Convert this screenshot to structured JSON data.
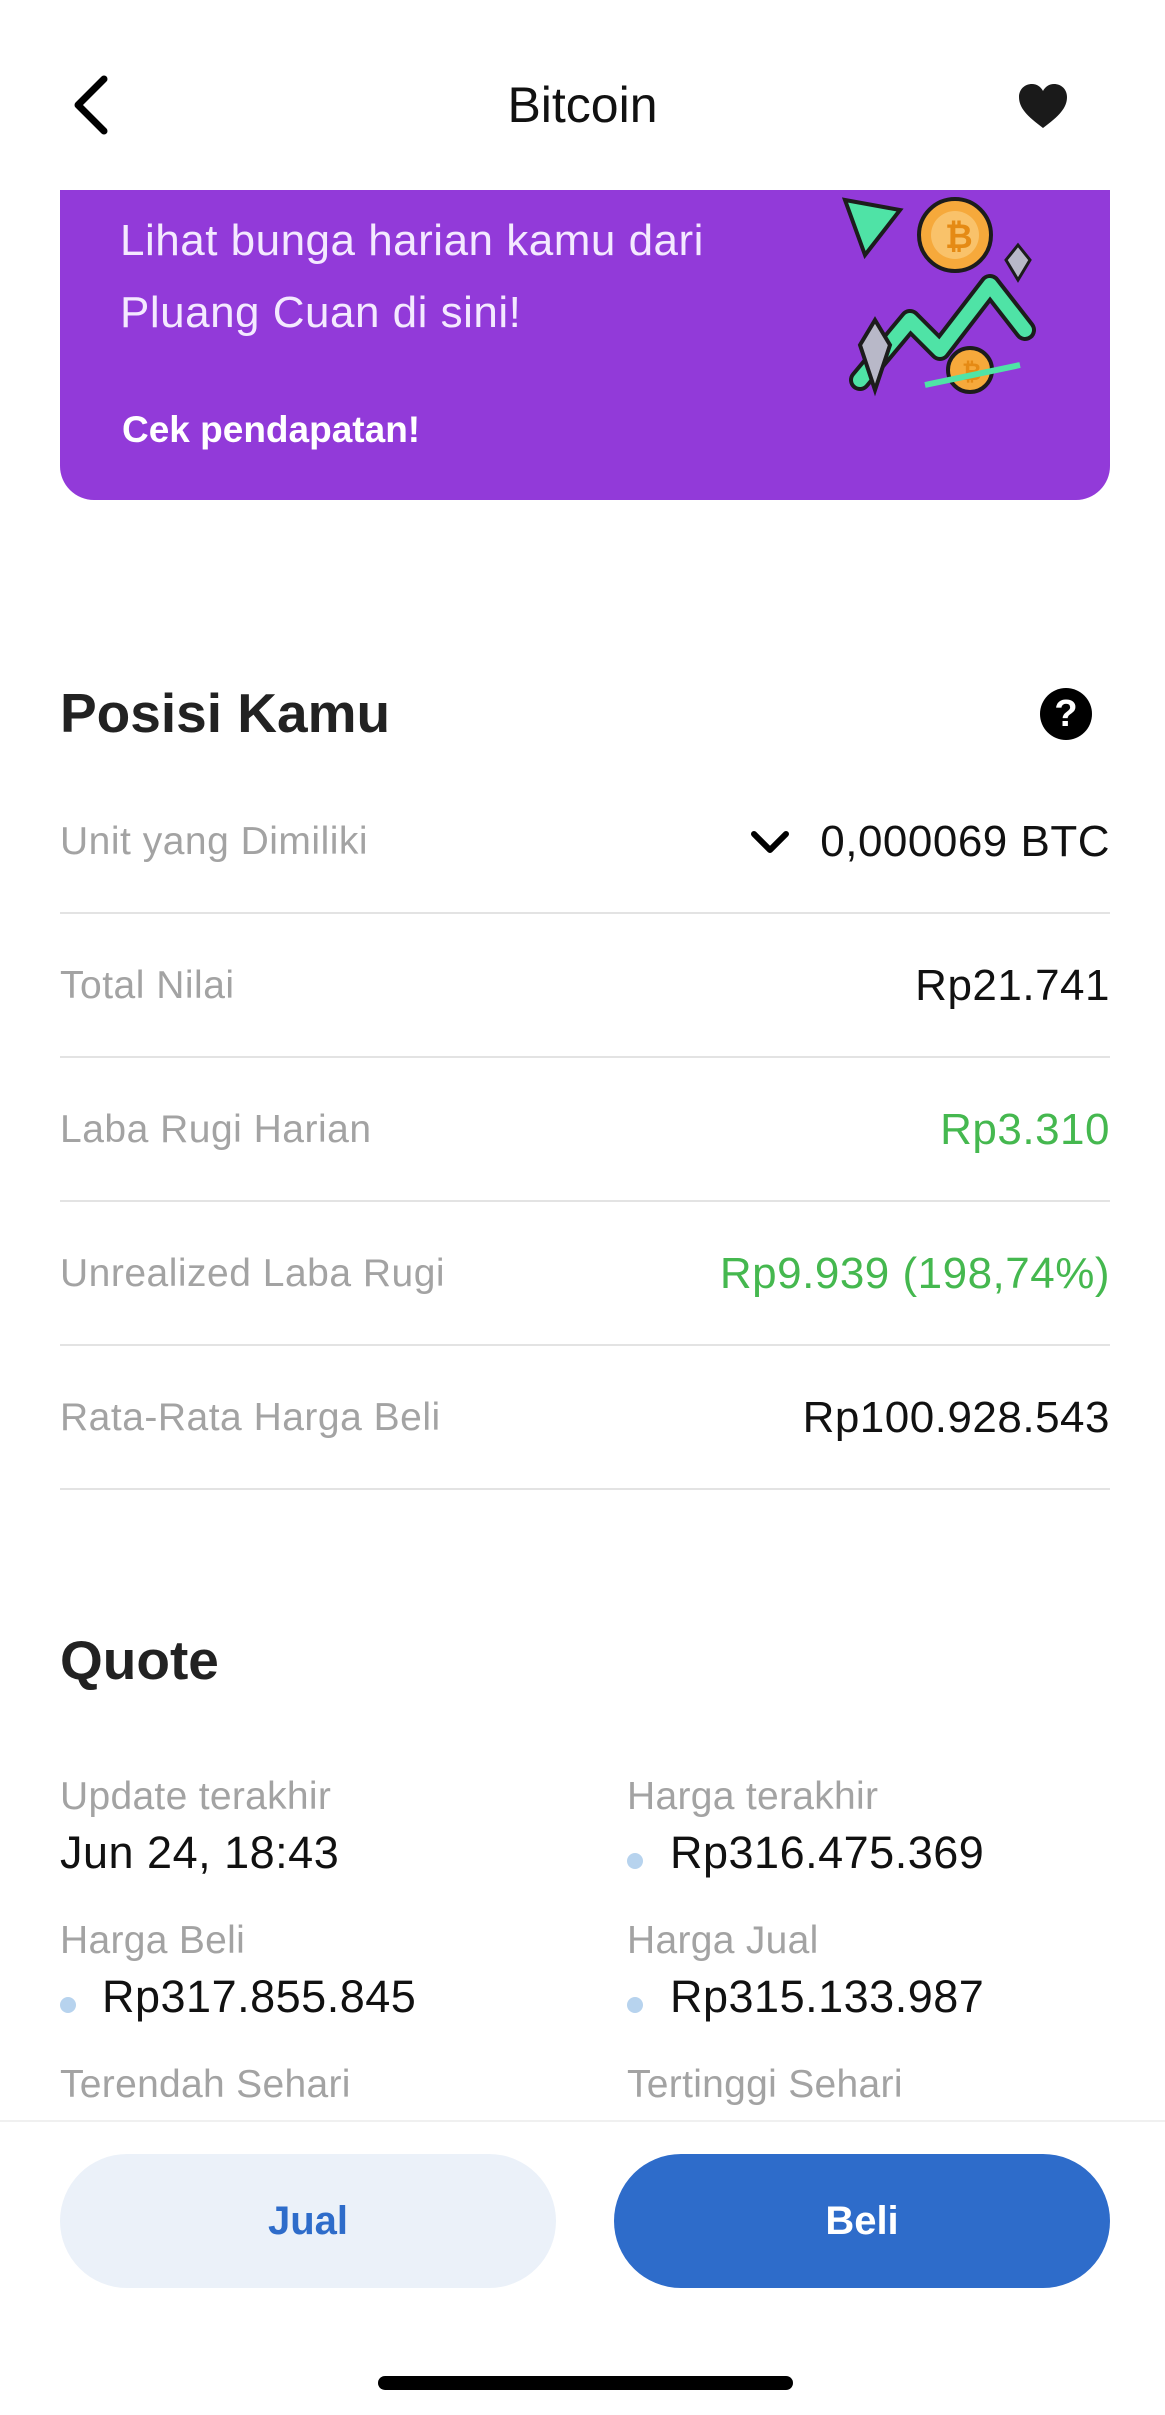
{
  "header": {
    "title": "Bitcoin",
    "back_icon": "chevron-left-icon",
    "favorite_icon": "heart-icon"
  },
  "promo": {
    "line1": "Lihat bunga harian kamu dari",
    "line2": "Pluang Cuan di sini!",
    "cta": "Cek pendapatan!",
    "background_color": "#923ad9",
    "illustration_icon": "crypto-growth-chart-icon"
  },
  "position": {
    "title": "Posisi Kamu",
    "help_label": "?",
    "rows": [
      {
        "label": "Unit yang Dimiliki",
        "value": "0,000069 BTC"
      },
      {
        "label": "Total Nilai",
        "value": "Rp21.741"
      },
      {
        "label": "Laba Rugi Harian",
        "value": "Rp3.310"
      },
      {
        "label": "Unrealized Laba Rugi",
        "value": "Rp9.939 (198,74%)"
      },
      {
        "label": "Rata-Rata Harga Beli",
        "value": "Rp100.928.543"
      }
    ],
    "positive_color": "#45b84f"
  },
  "quote": {
    "title": "Quote",
    "last_update_label": "Update terakhir",
    "last_update_value": "Jun 24, 18:43",
    "last_price_label": "Harga terakhir",
    "last_price_value": "Rp316.475.369",
    "buy_price_label": "Harga Beli",
    "buy_price_value": "Rp317.855.845",
    "sell_price_label": "Harga Jual",
    "sell_price_value": "Rp315.133.987",
    "day_low_label": "Terendah Sehari",
    "day_high_label": "Tertinggi Sehari"
  },
  "actions": {
    "sell_label": "Jual",
    "buy_label": "Beli",
    "accent_color": "#2e6cca"
  }
}
